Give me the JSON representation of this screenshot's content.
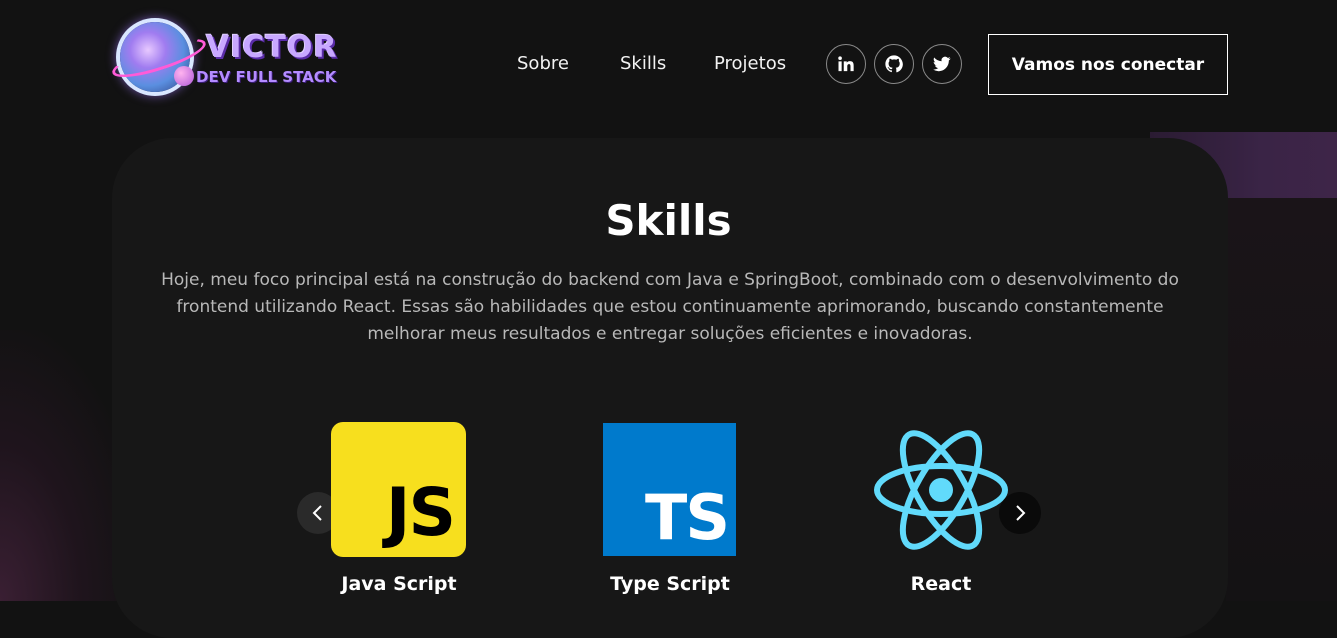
{
  "brand": {
    "title": "VICTOR",
    "subtitle": "DEV FULL STACK"
  },
  "nav": {
    "links": [
      "Sobre",
      "Skills",
      "Projetos"
    ],
    "socials": [
      "linkedin-icon",
      "github-icon",
      "twitter-icon"
    ],
    "connect_label": "Vamos nos conectar"
  },
  "skills": {
    "title": "Skills",
    "description": "Hoje, meu foco principal está na construção do backend com Java e SpringBoot, combinado com o desenvolvimento do frontend utilizando React. Essas são habilidades que estou continuamente aprimorando, buscando constantemente melhorar meus resultados e entregar soluções eficientes e inovadoras.",
    "items": [
      {
        "label": "Java Script",
        "logo_text": "JS",
        "color": "#f7df1e"
      },
      {
        "label": "Type Script",
        "logo_text": "TS",
        "color": "#007acc"
      },
      {
        "label": "React",
        "logo_text": "",
        "color": "#61dafb"
      }
    ]
  },
  "colors": {
    "background": "#121212",
    "card": "#171717",
    "accent_purple": "#3e2548"
  }
}
